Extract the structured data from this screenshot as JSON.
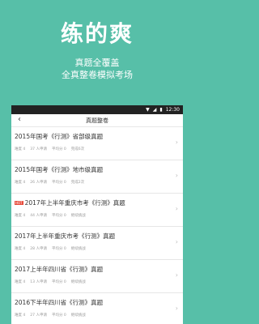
{
  "hero": {
    "title": "练的爽",
    "line1": "真题全覆盖",
    "line2": "全真整卷模拟考场"
  },
  "statusbar": {
    "time": "12:30"
  },
  "appbar": {
    "back_icon": "back-icon",
    "title": "真题整卷"
  },
  "items": [
    {
      "title": "2015年国考《行测》省部级真题",
      "hot": "",
      "difficulty": "难度 4",
      "count": "37 人申请",
      "score": "平均分 0",
      "status": "完成6次"
    },
    {
      "title": "2015年国考《行测》地市级真题",
      "hot": "",
      "difficulty": "难度 4",
      "count": "26 人申请",
      "score": "平均分 0",
      "status": "完成2次"
    },
    {
      "title": "2017年上半年重庆市考《行测》真题",
      "hot": "HOT",
      "difficulty": "难度 4",
      "count": "44 人申请",
      "score": "平均分 0",
      "status": "继续挑战"
    },
    {
      "title": "2017年上半年重庆市考《行测》真题",
      "hot": "",
      "difficulty": "难度 4",
      "count": "28 人申请",
      "score": "平均分 0",
      "status": "继续挑战"
    },
    {
      "title": "2017上半年四川省《行测》真题",
      "hot": "",
      "difficulty": "难度 4",
      "count": "13 人申请",
      "score": "平均分 0",
      "status": "继续挑战"
    },
    {
      "title": "2016下半年四川省《行测》真题",
      "hot": "",
      "difficulty": "难度 4",
      "count": "27 人申请",
      "score": "平均分 0",
      "status": "继续挑战"
    }
  ]
}
